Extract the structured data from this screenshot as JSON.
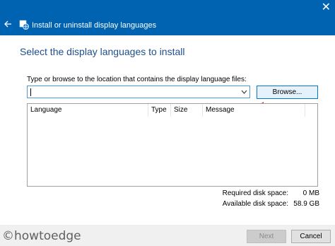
{
  "window": {
    "title": "Install or uninstall display languages",
    "close_glyph": "✕"
  },
  "page": {
    "heading": "Select the display languages to install",
    "prompt": "Type or browse to the location that contains the display language files:"
  },
  "path_field": {
    "value": "",
    "placeholder": ""
  },
  "browse_label": "Browse...",
  "table": {
    "columns": [
      "Language",
      "Type",
      "Size",
      "Message"
    ],
    "rows": []
  },
  "disk": {
    "required_label": "Required disk space:",
    "required_value": "0 MB",
    "available_label": "Available disk space:",
    "available_value": "58.9 GB"
  },
  "footer": {
    "watermark": "©howtoedge",
    "next_label": "Next",
    "cancel_label": "Cancel"
  },
  "colors": {
    "titlebar": "#0063b1",
    "heading": "#1e4e8c",
    "accent": "#0078d7",
    "annotation_arrow": "#e02020"
  },
  "icons": [
    "close-icon",
    "back-arrow-icon",
    "language-globe-icon",
    "dropdown-chevron-icon"
  ]
}
